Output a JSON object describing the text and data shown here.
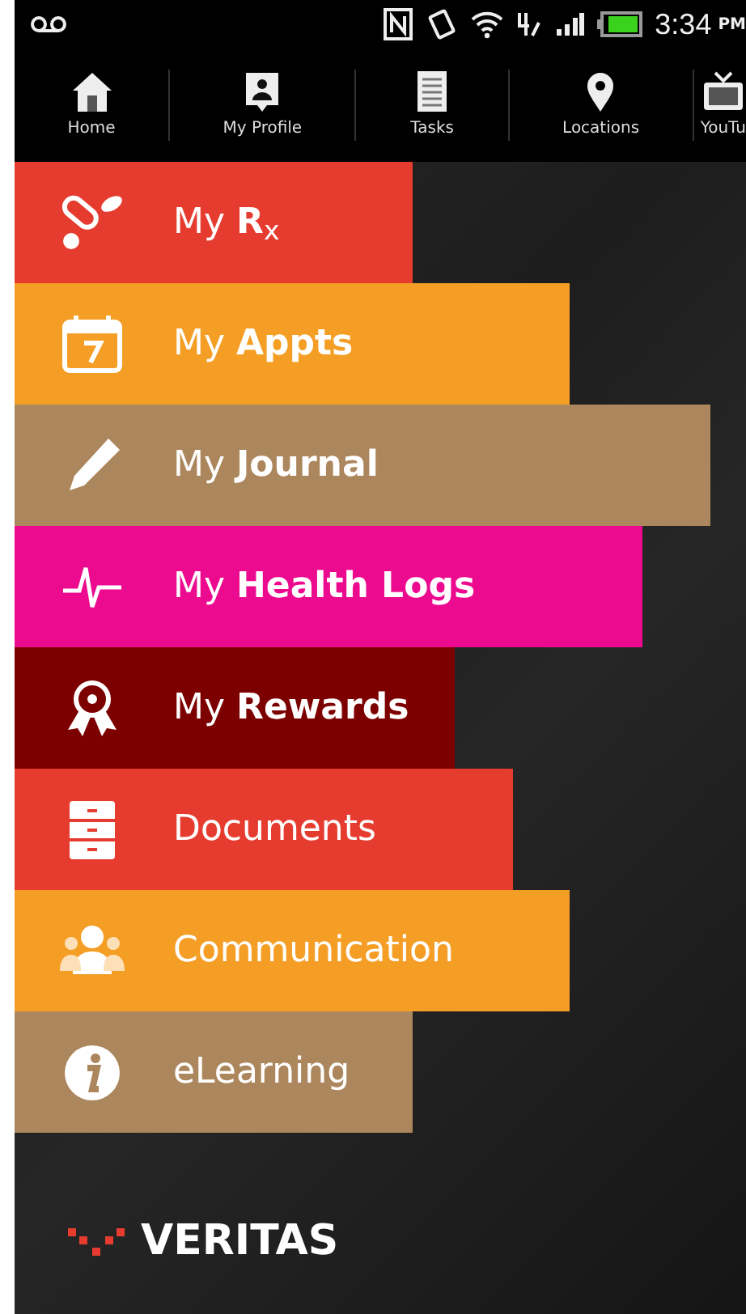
{
  "status_bar": {
    "time": "3:34",
    "meridiem": "PM"
  },
  "nav_tabs": [
    {
      "label": "Home",
      "kind": "home"
    },
    {
      "label": "My Profile",
      "kind": "profile"
    },
    {
      "label": "Tasks",
      "kind": "tasks"
    },
    {
      "label": "Locations",
      "kind": "pin"
    },
    {
      "label": "YouTu",
      "kind": "tv"
    }
  ],
  "menu": [
    {
      "label": "My **R**$_{x}$",
      "kind": "pills",
      "color": "#e63c2f"
    },
    {
      "label": "My **Appts**",
      "kind": "calendar",
      "color": "#f59e26"
    },
    {
      "label": "My **Journal**",
      "kind": "pencil",
      "color": "#ac865c"
    },
    {
      "label": "My **Health Logs**",
      "kind": "pulse",
      "color": "#ec0b8f"
    },
    {
      "label": "My **Rewards**",
      "kind": "award",
      "color": "#7d0000"
    },
    {
      "label": "Documents",
      "kind": "cabinet",
      "color": "#e63c2f"
    },
    {
      "label": "Communication",
      "kind": "people",
      "color": "#f59e26"
    },
    {
      "label": "eLearning",
      "kind": "info",
      "color": "#ac865c"
    }
  ],
  "brand": {
    "name": "VERITAS"
  }
}
